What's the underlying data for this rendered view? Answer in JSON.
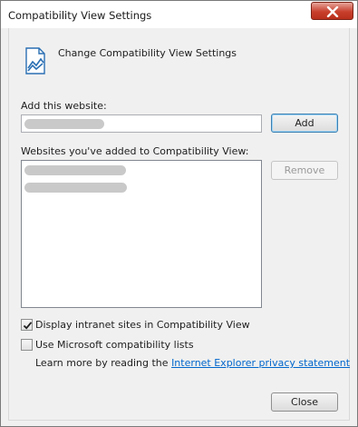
{
  "window": {
    "title": "Compatibility View Settings",
    "close_icon": "close-x-icon"
  },
  "header": {
    "icon": "compatibility-view-icon",
    "text": "Change Compatibility View Settings"
  },
  "add_website": {
    "label": "Add this website:",
    "value_redacted": true,
    "add_button": "Add"
  },
  "websites_list": {
    "label": "Websites you've added to Compatibility View:",
    "items_redacted_count": 2,
    "remove_button": "Remove"
  },
  "options": {
    "display_intranet": {
      "label": "Display intranet sites in Compatibility View",
      "checked": true
    },
    "use_ms_lists": {
      "label": "Use Microsoft compatibility lists",
      "checked": false
    }
  },
  "learn_more": {
    "text": "Learn more by reading the",
    "link": "Internet Explorer privacy statement"
  },
  "footer": {
    "close_button": "Close"
  }
}
